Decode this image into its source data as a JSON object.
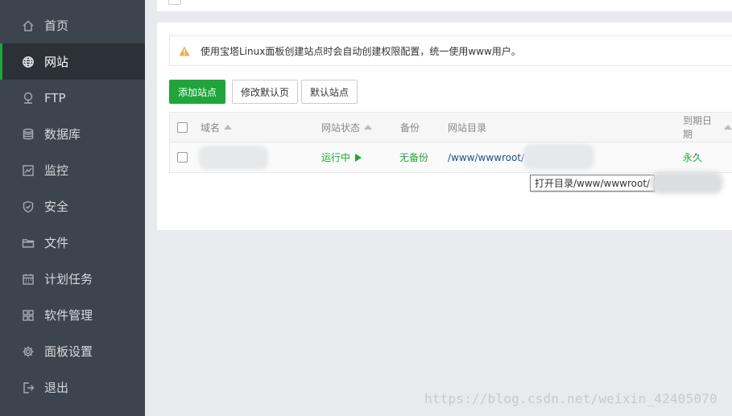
{
  "sidebar": {
    "items": [
      {
        "label": "首页",
        "icon": "home-icon"
      },
      {
        "label": "网站",
        "icon": "globe-icon",
        "active": true
      },
      {
        "label": "FTP",
        "icon": "ftp-icon"
      },
      {
        "label": "数据库",
        "icon": "database-icon"
      },
      {
        "label": "监控",
        "icon": "monitor-icon"
      },
      {
        "label": "安全",
        "icon": "shield-icon"
      },
      {
        "label": "文件",
        "icon": "folder-icon"
      },
      {
        "label": "计划任务",
        "icon": "calendar-icon"
      },
      {
        "label": "软件管理",
        "icon": "grid-icon"
      },
      {
        "label": "面板设置",
        "icon": "gear-icon"
      },
      {
        "label": "退出",
        "icon": "logout-icon"
      }
    ]
  },
  "notice": {
    "text": "使用宝塔Linux面板创建站点时会自动创建权限配置，统一使用www用户。",
    "icon": "warning-icon"
  },
  "toolbar": {
    "add_site": "添加站点",
    "edit_default_page": "修改默认页",
    "default_site": "默认站点"
  },
  "table": {
    "headers": {
      "domain": "域名",
      "status": "网站状态",
      "backup": "备份",
      "root": "网站目录",
      "expire": "到期日期"
    },
    "rows": [
      {
        "status": "运行中",
        "backup": "无备份",
        "root": "/www/wwwroot/",
        "expire": "永久"
      }
    ]
  },
  "tooltip": {
    "text": "打开目录/www/wwwroot/"
  },
  "watermark": {
    "text": "https://blog.csdn.net/weixin_42405070"
  },
  "colors": {
    "accent": "#20a53a",
    "sidebar_bg": "#3c444d",
    "warning": "#f0ad4e"
  }
}
